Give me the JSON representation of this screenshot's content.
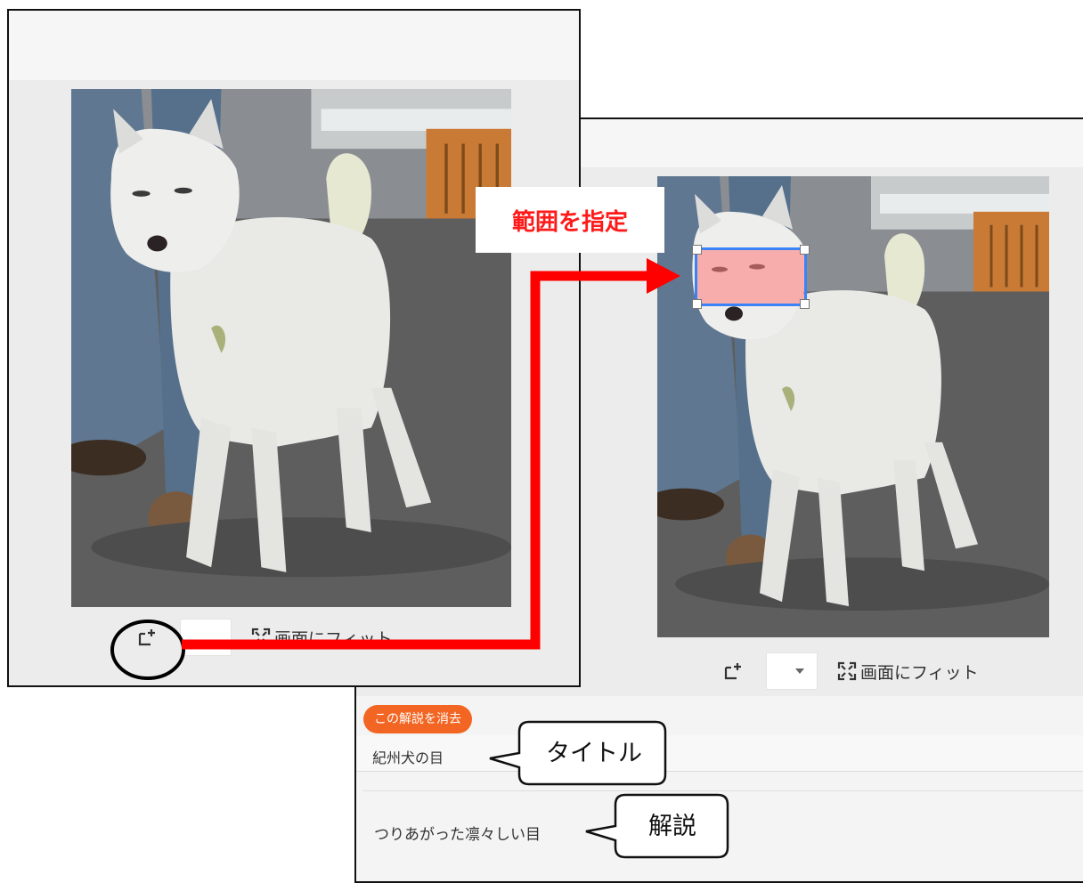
{
  "left_panel": {
    "toolbar": {
      "add_region_icon": "add-region-icon",
      "zoom_value": "",
      "fit_label": "画面にフィット"
    }
  },
  "right_panel": {
    "toolbar": {
      "add_region_icon": "add-region-icon",
      "zoom_value": "",
      "fit_label": "画面にフィット"
    },
    "annotation": {
      "delete_label": "この解説を消去",
      "title_value": "紀州犬の目",
      "description_value": "つりあがった凛々しい目"
    }
  },
  "banner_text": "範囲を指定",
  "callouts": {
    "title": "タイトル",
    "description": "解説"
  },
  "colors": {
    "arrow": "#ff0000",
    "delete_button": "#f26522",
    "selection_border": "#3b82f6"
  }
}
